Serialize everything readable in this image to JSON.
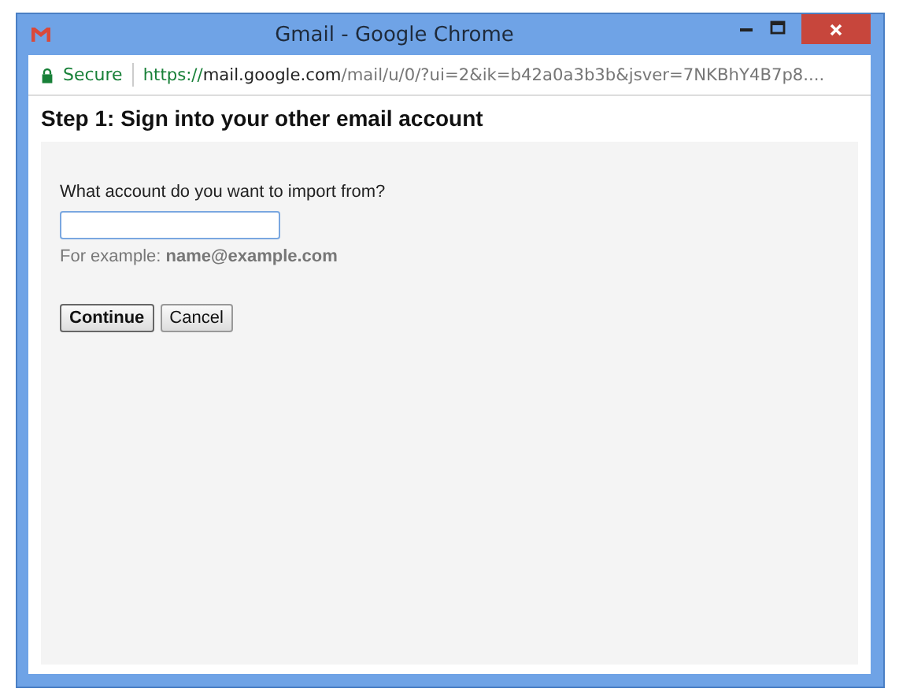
{
  "window": {
    "title": "Gmail - Google Chrome"
  },
  "address_bar": {
    "secure_label": "Secure",
    "url_scheme": "https://",
    "url_host": "mail.google.com",
    "url_path": "/mail/u/0/?ui=2&ik=b42a0a3b3b&jsver=7NKBhY4B7p8...."
  },
  "heading": "Step 1: Sign into your other email account",
  "form": {
    "label": "What account do you want to import from?",
    "hint": "For example: **name@example.com**"
  },
  "buttons": [
    {
      "label": "Continue",
      "kind": "primary"
    },
    {
      "label": "Cancel",
      "kind": "secondary"
    }
  ]
}
